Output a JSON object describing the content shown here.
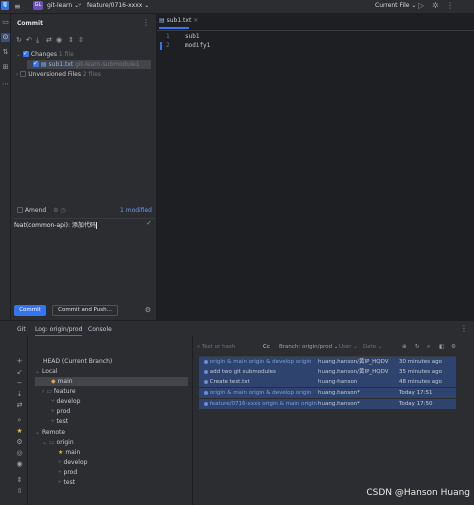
{
  "titlebar": {
    "project_badge": "GL",
    "project": "git-learn",
    "branch": "feature/0716-xxxx",
    "run_config": "Current File"
  },
  "commit_panel": {
    "title": "Commit",
    "changes_label": "Changes",
    "changes_count": "1 file",
    "file_name": "sub1.txt",
    "file_path": "git-learn-submodule1",
    "unversioned_label": "Unversioned Files",
    "unversioned_count": "2 files",
    "amend_label": "Amend",
    "modified_count": "1 modified",
    "commit_message": "feat(common-api): 添加代码",
    "commit_button": "Commit",
    "commit_push_button": "Commit and Push..."
  },
  "editor": {
    "tab_name": "sub1.txt",
    "lines": [
      {
        "num": "1",
        "text": "sub1"
      },
      {
        "num": "2",
        "text": "modify1"
      }
    ]
  },
  "bottom": {
    "tabs": [
      "Git",
      "Log: origin/prod",
      "Console"
    ],
    "branches": {
      "head": "HEAD (Current Branch)",
      "local_label": "Local",
      "local": [
        "main",
        "feature",
        "develop",
        "prod",
        "test"
      ],
      "remote_label": "Remote",
      "remote_group": "origin",
      "remote": [
        "main",
        "develop",
        "prod",
        "test"
      ]
    },
    "log_toolbar": {
      "search_placeholder": "Text or hash",
      "case_label": "Cc",
      "branch_filter": "Branch: origin/prod",
      "user_filter": "User",
      "date_filter": "Date"
    },
    "log_rows": [
      {
        "refs": "origin & main  origin & develop  origin",
        "message": "",
        "author": "huang.hanson/黄",
        "author_suffix": "IP_HQDV",
        "time": "30 minutes ago"
      },
      {
        "refs": "",
        "message": "add two git submodules",
        "author": "huang.hanson/黄",
        "author_suffix": "IP_HQDV",
        "time": "35 minutes ago"
      },
      {
        "refs": "",
        "message": "Create test.txt",
        "author": "huang-hanson",
        "author_suffix": "",
        "time": "48 minutes ago"
      },
      {
        "refs": "origin & main  origin & develop  origin",
        "message": "",
        "author": "huang.hanson*",
        "author_suffix": "",
        "time": "Today 17:51"
      },
      {
        "refs": "feature/0716-xxxx  origin & main  origin",
        "message": "",
        "author": "huang.hanson*",
        "author_suffix": "",
        "time": "Today 17:50"
      }
    ]
  },
  "watermark": "CSDN @Hanson Huang",
  "colors": {
    "accent": "#3574f0",
    "panel": "#2b2d30",
    "editor_bg": "#1e1f22",
    "log_highlight": "#2e436e"
  }
}
